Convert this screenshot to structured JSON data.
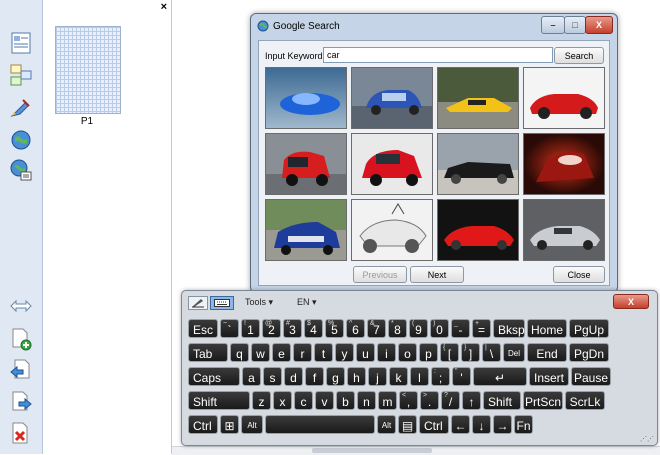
{
  "panel": {
    "close_label": "×",
    "page_label": "P1"
  },
  "tools": [
    {
      "icon": "page-layout-icon"
    },
    {
      "icon": "page-sorter-icon"
    },
    {
      "icon": "pen-tool-icon"
    },
    {
      "icon": "globe-icon"
    },
    {
      "icon": "internet-search-icon"
    },
    {
      "icon": "resize-arrows-icon"
    },
    {
      "icon": "add-page-icon"
    },
    {
      "icon": "previous-page-icon"
    },
    {
      "icon": "next-page-icon"
    },
    {
      "icon": "delete-page-icon"
    }
  ],
  "search_window": {
    "title": "Google Search",
    "keyword_label": "Input Keyword:",
    "keyword_value": "car",
    "search_label": "Search",
    "previous_label": "Previous",
    "next_label": "Next",
    "close_label": "Close",
    "minimize_label": "–",
    "maximize_label": "□",
    "close_x": "X",
    "result_count": 12
  },
  "keyboard": {
    "tools_label": "Tools ▾",
    "lang_label": "EN ▾",
    "close_x": "X",
    "rows": [
      [
        [
          "Esc",
          ""
        ],
        [
          "`",
          "~"
        ],
        [
          "1",
          "!"
        ],
        [
          "2",
          "@"
        ],
        [
          "3",
          "#"
        ],
        [
          "4",
          "$"
        ],
        [
          "5",
          "%"
        ],
        [
          "6",
          "^"
        ],
        [
          "7",
          "&"
        ],
        [
          "8",
          "*"
        ],
        [
          "9",
          "("
        ],
        [
          "0",
          ")"
        ],
        [
          "-",
          "_"
        ],
        [
          "=",
          "+"
        ],
        [
          "Bksp",
          ""
        ],
        [
          "Home",
          ""
        ],
        [
          "PgUp",
          ""
        ]
      ],
      [
        [
          "Tab",
          ""
        ],
        [
          "q",
          ""
        ],
        [
          "w",
          ""
        ],
        [
          "e",
          ""
        ],
        [
          "r",
          ""
        ],
        [
          "t",
          ""
        ],
        [
          "y",
          ""
        ],
        [
          "u",
          ""
        ],
        [
          "i",
          ""
        ],
        [
          "o",
          ""
        ],
        [
          "p",
          ""
        ],
        [
          "[",
          "{"
        ],
        [
          "]",
          "}"
        ],
        [
          "\\",
          "|"
        ],
        [
          "Del",
          ""
        ],
        [
          "End",
          ""
        ],
        [
          "PgDn",
          ""
        ]
      ],
      [
        [
          "Caps",
          ""
        ],
        [
          "a",
          ""
        ],
        [
          "s",
          ""
        ],
        [
          "d",
          ""
        ],
        [
          "f",
          ""
        ],
        [
          "g",
          ""
        ],
        [
          "h",
          ""
        ],
        [
          "j",
          ""
        ],
        [
          "k",
          ""
        ],
        [
          "l",
          ""
        ],
        [
          ";",
          ":"
        ],
        [
          "'",
          "\""
        ],
        [
          "↵",
          ""
        ],
        [
          "Insert",
          ""
        ],
        [
          "Pause",
          ""
        ]
      ],
      [
        [
          "Shift",
          ""
        ],
        [
          "z",
          ""
        ],
        [
          "x",
          ""
        ],
        [
          "c",
          ""
        ],
        [
          "v",
          ""
        ],
        [
          "b",
          ""
        ],
        [
          "n",
          ""
        ],
        [
          "m",
          ""
        ],
        [
          ",",
          "<"
        ],
        [
          ".",
          ">"
        ],
        [
          "/",
          "?"
        ],
        [
          "↑",
          ""
        ],
        [
          "Shift",
          ""
        ],
        [
          "PrtScn",
          ""
        ],
        [
          "ScrLk",
          ""
        ]
      ],
      [
        [
          "Ctrl",
          ""
        ],
        [
          "⊞",
          ""
        ],
        [
          "Alt",
          ""
        ],
        [
          "",
          ""
        ],
        [
          "Alt",
          ""
        ],
        [
          "▤",
          ""
        ],
        [
          "Ctrl",
          ""
        ],
        [
          "←",
          ""
        ],
        [
          "↓",
          ""
        ],
        [
          "→",
          ""
        ],
        [
          "Fn",
          ""
        ]
      ]
    ]
  },
  "colors": {
    "toolstrip": "#dfe8f3",
    "window_frame": "#c5d4e6",
    "key": "#262626",
    "close_red": "#c4402c"
  }
}
